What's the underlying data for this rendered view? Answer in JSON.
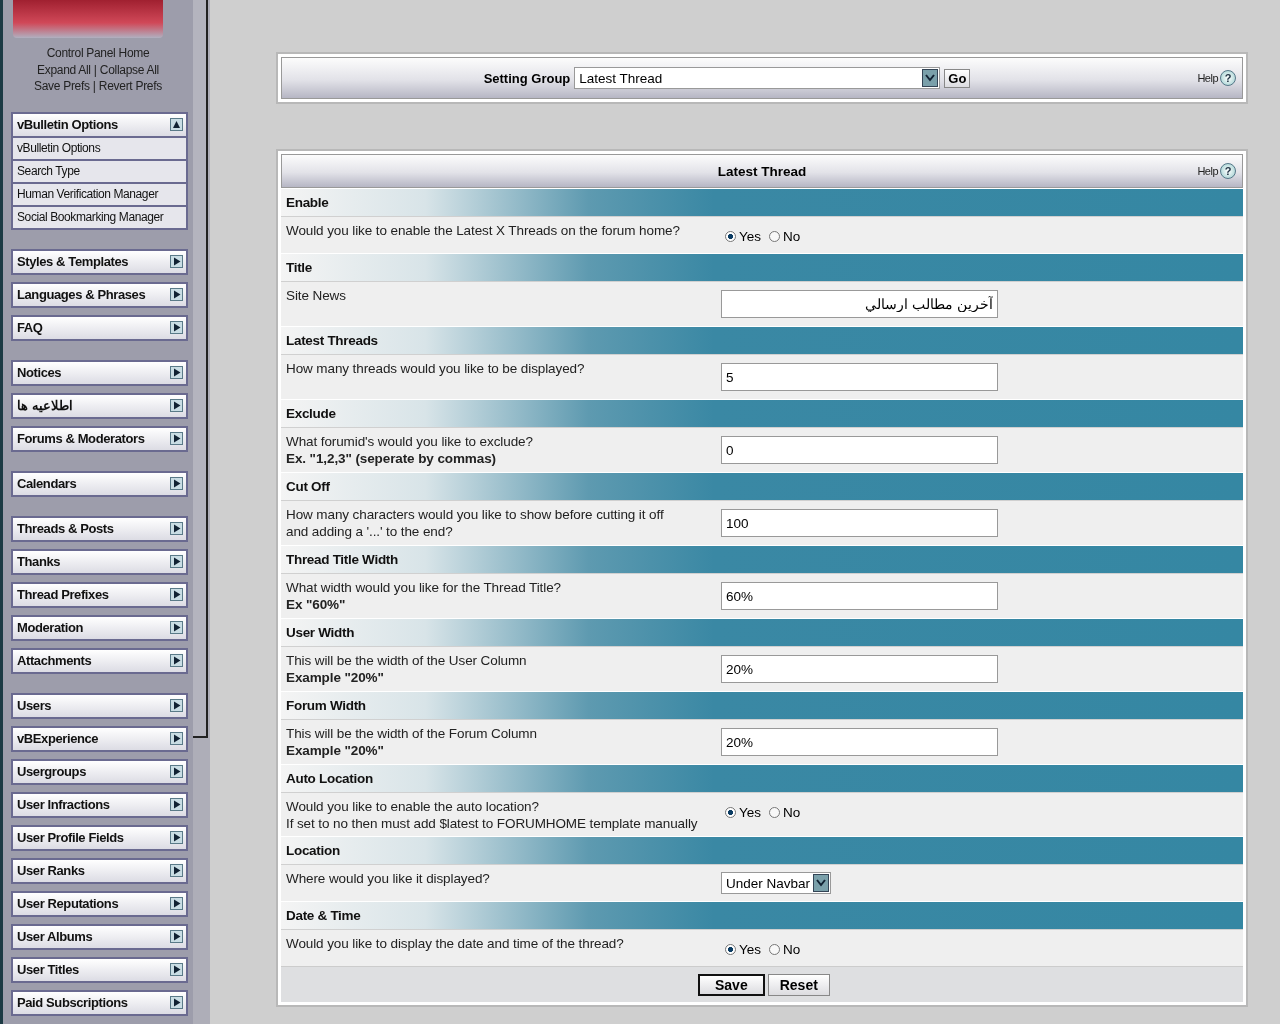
{
  "sidebar": {
    "separator": "|",
    "link_rows": [
      {
        "links": [
          "Control Panel Home"
        ]
      },
      {
        "links": [
          "Expand All",
          "Collapse All"
        ]
      },
      {
        "links": [
          "Save Prefs",
          "Revert Prefs"
        ]
      }
    ],
    "groups": [
      {
        "menus": [
          {
            "label": "vBulletin Options",
            "expanded": true,
            "items": [
              "vBulletin Options",
              "Search Type",
              "Human Verification Manager",
              "Social Bookmarking Manager"
            ]
          }
        ]
      },
      {
        "menus": [
          {
            "label": "Styles & Templates",
            "expanded": false
          },
          {
            "label": "Languages & Phrases",
            "expanded": false
          },
          {
            "label": "FAQ",
            "expanded": false
          }
        ]
      },
      {
        "menus": [
          {
            "label": "Notices",
            "expanded": false
          },
          {
            "label": "اطلاعيه ها",
            "expanded": false
          },
          {
            "label": "Forums & Moderators",
            "expanded": false
          }
        ]
      },
      {
        "menus": [
          {
            "label": "Calendars",
            "expanded": false
          }
        ]
      },
      {
        "menus": [
          {
            "label": "Threads & Posts",
            "expanded": false
          },
          {
            "label": "Thanks",
            "expanded": false
          },
          {
            "label": "Thread Prefixes",
            "expanded": false
          },
          {
            "label": "Moderation",
            "expanded": false
          },
          {
            "label": "Attachments",
            "expanded": false
          }
        ]
      },
      {
        "menus": [
          {
            "label": "Users",
            "expanded": false
          },
          {
            "label": "vBExperience",
            "expanded": false
          },
          {
            "label": "Usergroups",
            "expanded": false
          },
          {
            "label": "User Infractions",
            "expanded": false
          },
          {
            "label": "User Profile Fields",
            "expanded": false
          },
          {
            "label": "User Ranks",
            "expanded": false
          },
          {
            "label": "User Reputations",
            "expanded": false
          },
          {
            "label": "User Albums",
            "expanded": false
          },
          {
            "label": "User Titles",
            "expanded": false
          },
          {
            "label": "Paid Subscriptions",
            "expanded": false
          }
        ]
      }
    ]
  },
  "setting_group": {
    "label": "Setting Group",
    "value": "Latest Thread",
    "go": "Go",
    "help": {
      "label": "Help",
      "icon": "?"
    }
  },
  "settings_panel": {
    "title": "Latest Thread",
    "help": {
      "label": "Help",
      "icon": "?"
    },
    "settings": [
      {
        "title": "Enable",
        "kind": "radio",
        "description": [
          "Would you like to enable the Latest X Threads on the forum home?"
        ],
        "options": [
          {
            "label": "Yes",
            "selected": true
          },
          {
            "label": "No",
            "selected": false
          }
        ]
      },
      {
        "title": "Title",
        "kind": "text",
        "description": [
          "Site News"
        ],
        "value": "آخرين مطالب ارسالي"
      },
      {
        "title": "Latest Threads",
        "kind": "text",
        "description": [
          "How many threads would you like to be displayed?"
        ],
        "value": "5"
      },
      {
        "title": "Exclude",
        "kind": "text",
        "description": [
          "What forumid's would you like to exclude?",
          "**Ex. \"1,2,3\" (seperate by commas)**"
        ],
        "value": "0"
      },
      {
        "title": "Cut Off",
        "kind": "text",
        "description": [
          "How many characters would you like to show before cutting it off",
          "and adding a '...' to the end?"
        ],
        "value": "100"
      },
      {
        "title": "Thread Title Width",
        "kind": "text",
        "description": [
          "What width would you like for the Thread Title?",
          "**Ex \"60%\"**"
        ],
        "value": "60%"
      },
      {
        "title": "User Width",
        "kind": "text",
        "description": [
          "This will be the width of the User Column",
          "**Example \"20%\"**"
        ],
        "value": "20%"
      },
      {
        "title": "Forum Width",
        "kind": "text",
        "description": [
          "This will be the width of the Forum Column",
          "**Example \"20%\"**"
        ],
        "value": "20%"
      },
      {
        "title": "Auto Location",
        "kind": "radio",
        "description": [
          "Would you like to enable the auto location?",
          "If set to no then must add $latest to FORUMHOME template manually"
        ],
        "options": [
          {
            "label": "Yes",
            "selected": true
          },
          {
            "label": "No",
            "selected": false
          }
        ]
      },
      {
        "title": "Location",
        "kind": "select",
        "description": [
          "Where would you like it displayed?"
        ],
        "value": "Under Navbar"
      },
      {
        "title": "Date & Time",
        "kind": "radio",
        "description": [
          "Would you like to display the date and time of the thread?"
        ],
        "options": [
          {
            "label": "Yes",
            "selected": true
          },
          {
            "label": "No",
            "selected": false
          }
        ]
      }
    ],
    "buttons": [
      {
        "label": "Save",
        "kind": "default"
      },
      {
        "label": "Reset",
        "kind": "plain"
      }
    ]
  }
}
